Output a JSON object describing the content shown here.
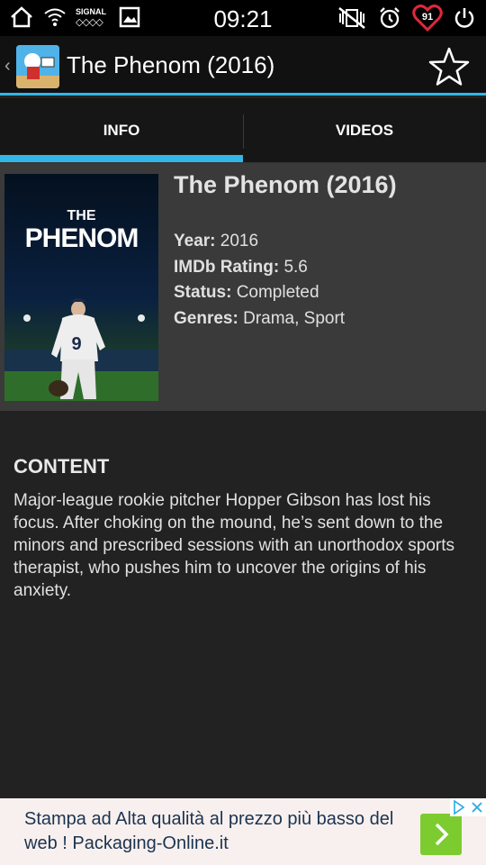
{
  "status_bar": {
    "time": "09:21",
    "signal_label": "SIGNAL",
    "battery_level": "91",
    "icons": [
      "home-icon",
      "wifi-icon",
      "signal-icon",
      "gallery-icon",
      "vibrate-off-icon",
      "alarm-icon",
      "battery-heart-icon",
      "power-icon"
    ]
  },
  "action_bar": {
    "title": "The Phenom (2016)",
    "icons": [
      "back-chevron-icon",
      "app-icon",
      "star-icon"
    ]
  },
  "tabs": [
    {
      "label": "INFO",
      "active": true
    },
    {
      "label": "VIDEOS",
      "active": false
    }
  ],
  "movie": {
    "title": "The Phenom (2016)",
    "poster_title_line1": "THE",
    "poster_title_line2": "PHENOM",
    "poster_jersey_number": "9",
    "year_label": "Year:",
    "year": "2016",
    "rating_label": "IMDb Rating:",
    "rating": "5.6",
    "status_label": "Status:",
    "status": "Completed",
    "genres_label": "Genres:",
    "genres": "Drama, Sport"
  },
  "content": {
    "heading": "CONTENT",
    "text": "Major-league rookie pitcher Hopper Gibson has lost his focus. After choking on the mound, he’s sent down to the minors and prescribed sessions with an unorthodox sports therapist, who pushes him to uncover the origins of his anxiety."
  },
  "ad": {
    "text": "Stampa ad Alta qualità al prezzo più basso del web ! Packaging-Online.it"
  },
  "colors": {
    "accent": "#33b5e5",
    "ad_button": "#7ccc2f"
  }
}
